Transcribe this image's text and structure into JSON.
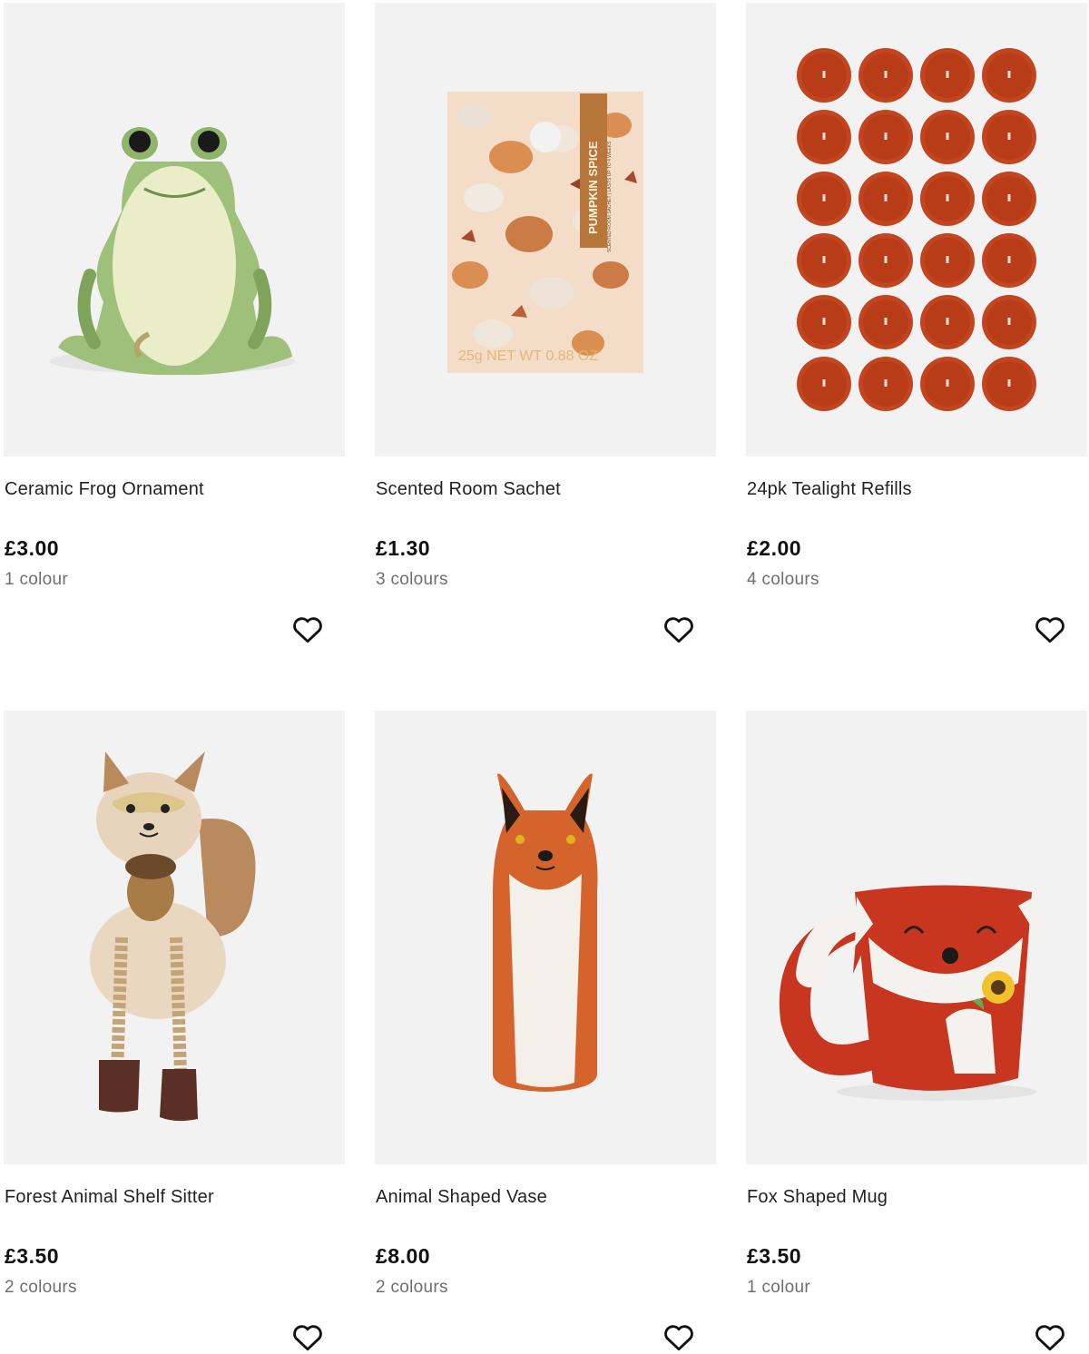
{
  "products": [
    {
      "name": "Ceramic Frog Ornament",
      "price": "£3.00",
      "colours": "1 colour",
      "image": "frog-ornament"
    },
    {
      "name": "Scented Room Sachet",
      "price": "£1.30",
      "colours": "3 colours",
      "image": "pumpkin-sachet"
    },
    {
      "name": "24pk Tealight Refills",
      "price": "£2.00",
      "colours": "4 colours",
      "image": "tealights"
    },
    {
      "name": "Forest Animal Shelf Sitter",
      "price": "£3.50",
      "colours": "2 colours",
      "image": "squirrel-sitter"
    },
    {
      "name": "Animal Shaped Vase",
      "price": "£8.00",
      "colours": "2 colours",
      "image": "fox-vase"
    },
    {
      "name": "Fox Shaped Mug",
      "price": "£3.50",
      "colours": "1 colour",
      "image": "fox-mug"
    }
  ],
  "sachet_label": {
    "brand": "PUMPKIN SPICE",
    "sub": "SCENTED ROOM SACHET | LASTS UP TO 4 WEEKS",
    "weight": "25g  NET WT 0.88 OZ"
  },
  "icons": {
    "favourite": "heart-outline-icon"
  },
  "colors": {
    "tile_bg": "#f2f2f2",
    "tealight": "#c2451f",
    "text_muted": "#6e6e6e"
  }
}
